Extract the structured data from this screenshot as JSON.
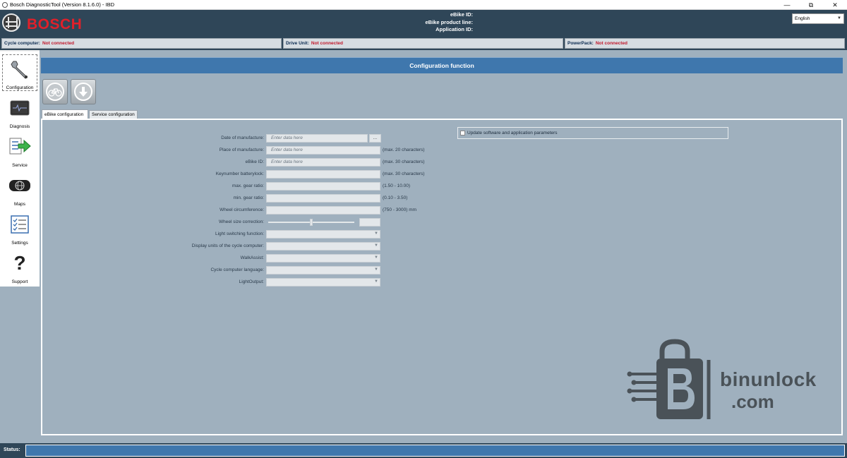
{
  "window": {
    "title": "Bosch DiagnosticTool (Version 8.1.6.0) - IBD",
    "minimize": "—",
    "maximize": "⧉",
    "close": "✕"
  },
  "header": {
    "brand": "BOSCH",
    "ebike_id_label": "eBike ID:",
    "product_line_label": "eBike product line:",
    "application_id_label": "Application ID:",
    "language": "English"
  },
  "connections": [
    {
      "label": "Cycle computer:",
      "status": "Not connected"
    },
    {
      "label": "Drive Unit:",
      "status": "Not connected"
    },
    {
      "label": "PowerPack:",
      "status": "Not connected"
    }
  ],
  "nav": [
    {
      "label": "Configuration",
      "icon": "wrench-icon",
      "active": true
    },
    {
      "label": "Diagnosis",
      "icon": "oscilloscope-icon",
      "active": false
    },
    {
      "label": "Service",
      "icon": "service-arrow-icon",
      "active": false
    },
    {
      "label": "Maps",
      "icon": "globe-device-icon",
      "active": false
    },
    {
      "label": "Settings",
      "icon": "checklist-icon",
      "active": false
    },
    {
      "label": "Support",
      "icon": "question-mark-icon",
      "active": false
    }
  ],
  "section_title": "Configuration function",
  "tabs": [
    {
      "label": "eBike configuration",
      "active": true
    },
    {
      "label": "Service configuration",
      "active": false
    }
  ],
  "form": {
    "date_label": "Date of manufacture:",
    "date_placeholder": "Enter data here",
    "date_button": "...",
    "place_label": "Place of manufacture:",
    "place_placeholder": "Enter data here",
    "place_note": "(max. 20 characters)",
    "ebike_id_label": "eBike ID:",
    "ebike_id_placeholder": "Enter data here",
    "ebike_id_note": "(max. 30 characters)",
    "keynumber_label": "Keynumber batterylock:",
    "keynumber_note": "(max. 30 characters)",
    "max_gear_label": "max. gear ratio:",
    "max_gear_note": "(1.50 - 10.00)",
    "min_gear_label": "min. gear ratio:",
    "min_gear_note": "(0.10 - 3.50)",
    "wheel_circ_label": "Wheel circumference:",
    "wheel_circ_note": "(750 - 3000) mm",
    "wheel_size_label": "Wheel size correction:",
    "light_switching_label": "Light switching function:",
    "display_units_label": "Display units of the cycle computer:",
    "walkassist_label": "WalkAssist:",
    "cycle_lang_label": "Cycle computer language:",
    "lightoutput_label": "LightOutput:"
  },
  "update_option": {
    "label": "Update software and application parameters",
    "checked": false
  },
  "watermark": {
    "line1": "binunlock",
    "line2": ".com"
  },
  "status": {
    "label": "Status:",
    "value": ""
  },
  "colors": {
    "header_bg": "#2f4658",
    "panel_bg": "#9fb0be",
    "section_blue": "#3f77ad",
    "brand_red": "#e0202a",
    "not_connected_red": "#c0182b"
  }
}
